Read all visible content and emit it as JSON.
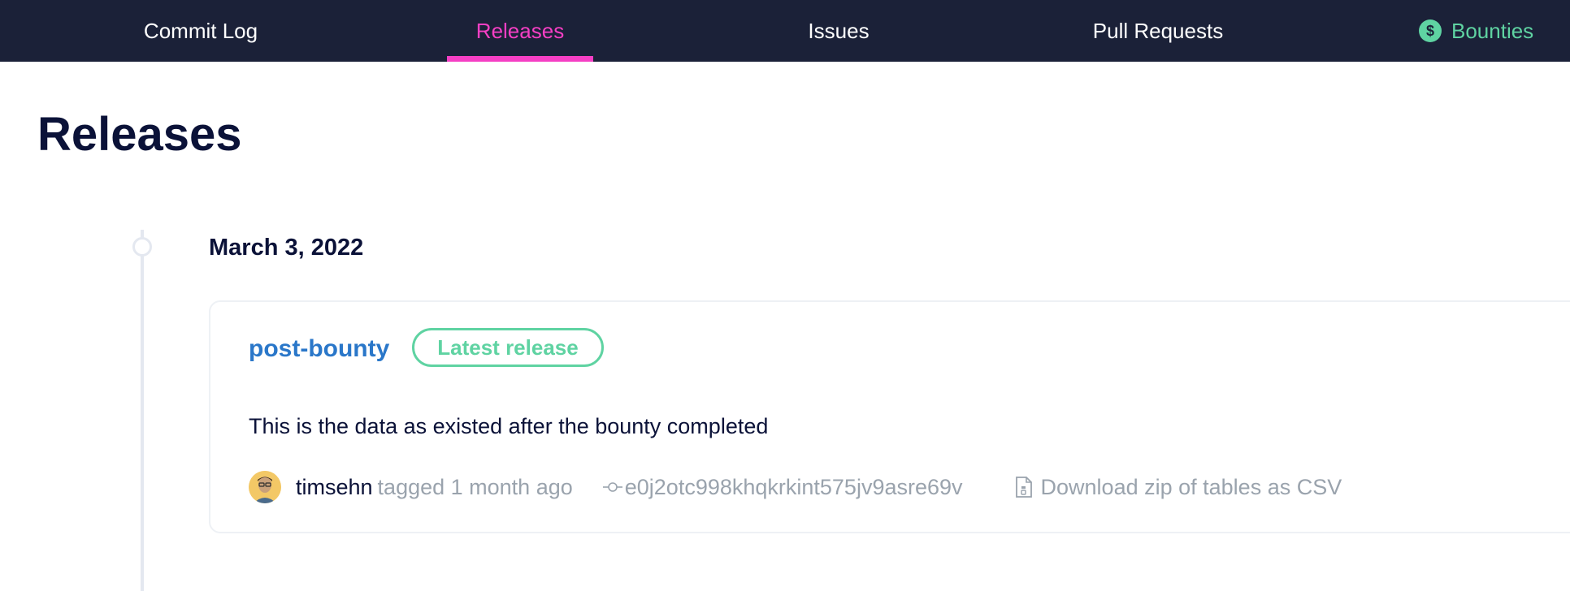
{
  "nav": {
    "tabs": [
      {
        "label": "Commit Log"
      },
      {
        "label": "Releases"
      },
      {
        "label": "Issues"
      },
      {
        "label": "Pull Requests"
      },
      {
        "label": "Bounties"
      }
    ],
    "active_tab": "Releases",
    "bounties_icon_symbol": "$"
  },
  "page": {
    "title": "Releases"
  },
  "release": {
    "date": "March 3, 2022",
    "name": "post-bounty",
    "badge": "Latest release",
    "description": "This is the data as existed after the bounty completed",
    "author": "timsehn",
    "tagged_text": "tagged 1 month ago",
    "commit_hash": "e0j2otc998khqkrkint575jv9asre69v",
    "download_label": "Download zip of tables as CSV"
  },
  "colors": {
    "nav_background": "#1b2138",
    "active_accent": "#f53fc4",
    "bounties_green": "#5fd3a2",
    "link_blue": "#2a77c9",
    "title_navy": "#0b1238",
    "muted_gray": "#9aa3ad"
  },
  "icons": [
    "dollar-icon",
    "commit-icon",
    "file-download-icon",
    "user-avatar"
  ]
}
